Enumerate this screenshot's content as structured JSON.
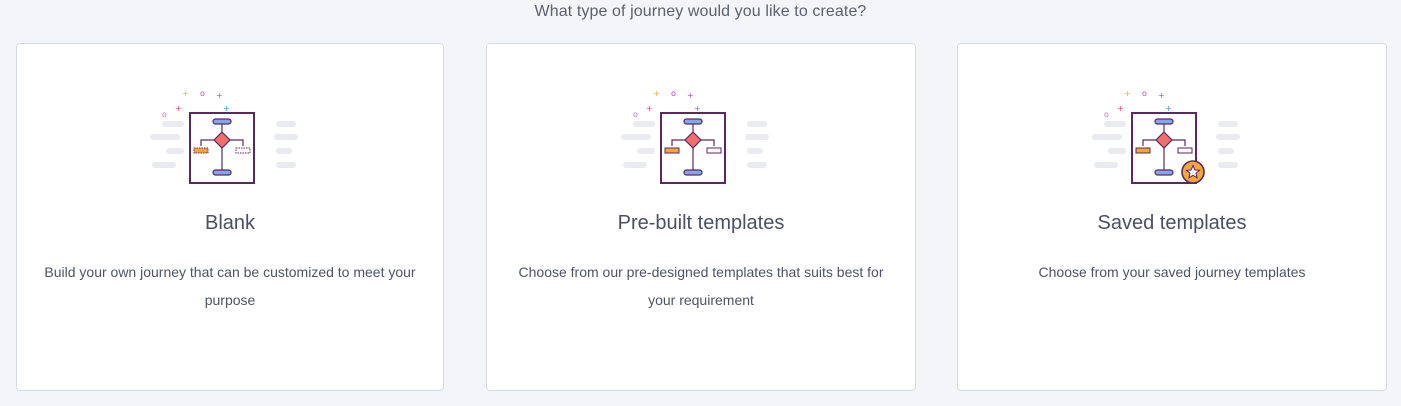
{
  "prompt": "What type of journey would you like to create?",
  "cards": [
    {
      "title": "Blank",
      "description": "Build your own journey that can be customized to meet your purpose",
      "icon": "flowchart-blank-icon"
    },
    {
      "title": "Pre-built templates",
      "description": "Choose from our pre-designed templates that suits best for your requirement",
      "icon": "flowchart-template-icon"
    },
    {
      "title": "Saved templates",
      "description": "Choose from your saved journey templates",
      "icon": "flowchart-saved-star-icon"
    }
  ],
  "colors": {
    "background": "#f3f5f9",
    "card_border": "#d7dce4",
    "icon_outline": "#5a2a5c",
    "icon_diamond": "#f26d6d",
    "icon_node_blue": "#7fa7ef",
    "icon_node_orange": "#f6a53a",
    "icon_star_badge": "#f6a53a"
  }
}
